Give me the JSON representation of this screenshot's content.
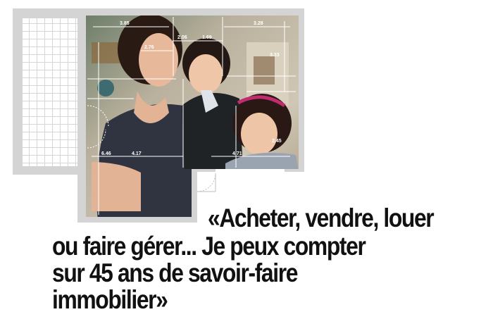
{
  "quote": {
    "line1": "«Acheter, vendre, louer",
    "line2": "ou faire gérer... Je peux compter",
    "line3": "sur 45 ans de savoir-faire",
    "line4": "immobilier»"
  },
  "floor_plan": {
    "dimensions": [
      "3.85",
      "2.06",
      "1.69",
      "3.28",
      "2.76",
      "3.33",
      "6.46",
      "4.17",
      "4.71",
      "2.45"
    ]
  },
  "photo": {
    "subject": "mother with two children"
  },
  "colors": {
    "wall": "#d4d4d4",
    "text": "#111111",
    "dimension_text": "#ffffff"
  }
}
